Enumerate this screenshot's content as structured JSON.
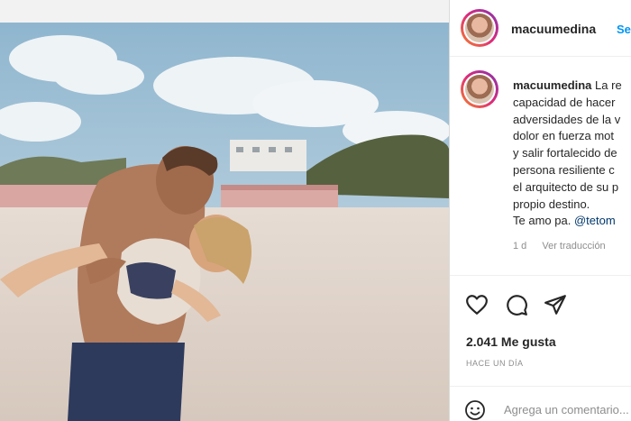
{
  "post": {
    "username": "macuumedina",
    "follow_label": "Se",
    "caption": {
      "user": "macuumedina",
      "first_line": "La re",
      "lines": [
        "capacidad de hacer",
        "adversidades de la v",
        "dolor en fuerza mot",
        "y salir fortalecido de",
        "persona resiliente c",
        "el arquitecto de su p",
        "propio destino."
      ],
      "closing": "Te amo pa.",
      "mention": "@tetom"
    },
    "meta": {
      "age": "1 d",
      "translate_label": "Ver traducción"
    },
    "likes": "2.041 Me gusta",
    "time_ago": "HACE UN DÍA",
    "comment": {
      "placeholder": "Agrega un comentario..."
    }
  },
  "icons": [
    "heart-icon",
    "comment-icon",
    "share-icon",
    "emoji-icon"
  ],
  "colors": {
    "link_blue": "#0095f6",
    "mention_blue": "#00376b",
    "muted": "#8e8e8e",
    "text": "#262626"
  }
}
